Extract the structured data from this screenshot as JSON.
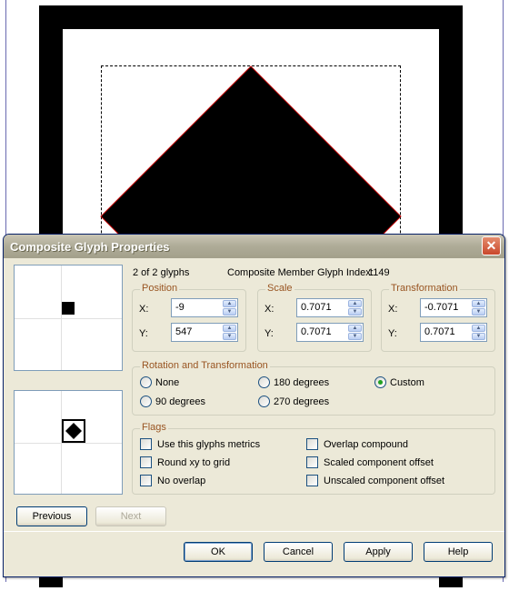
{
  "canvas": {
    "guide_color": "#6a6ab0",
    "baseline_color": "#b04040",
    "outline_color": "#c00000"
  },
  "dialog": {
    "title": "Composite Glyph Properties",
    "close_symbol": "✕",
    "glyph_count": "2 of 2 glyphs",
    "member_index_label": "Composite Member Glyph Index:",
    "member_index_value": "1149",
    "position": {
      "legend": "Position",
      "x_label": "X:",
      "x_value": "-9",
      "y_label": "Y:",
      "y_value": "547"
    },
    "scale": {
      "legend": "Scale",
      "x_label": "X:",
      "x_value": "0.7071",
      "y_label": "Y:",
      "y_value": "0.7071"
    },
    "transformation": {
      "legend": "Transformation",
      "x_label": "X:",
      "x_value": "-0.7071",
      "y_label": "Y:",
      "y_value": "0.7071"
    },
    "rotation": {
      "legend": "Rotation and Transformation",
      "options": [
        "None",
        "180 degrees",
        "Custom",
        "90 degrees",
        "270 degrees"
      ],
      "selected": "Custom"
    },
    "flags": {
      "legend": "Flags",
      "items": [
        "Use this glyphs metrics",
        "Overlap compound",
        "Round xy to grid",
        "Scaled component offset",
        "No overlap",
        "Unscaled component offset"
      ]
    },
    "buttons": {
      "previous": "Previous",
      "next": "Next",
      "ok": "OK",
      "cancel": "Cancel",
      "apply": "Apply",
      "help": "Help"
    }
  }
}
